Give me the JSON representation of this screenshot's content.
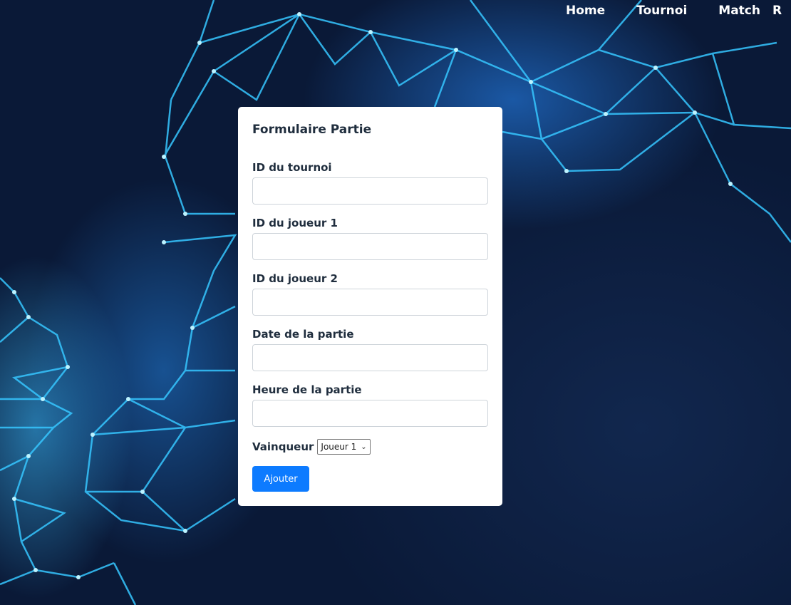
{
  "nav": {
    "items": [
      {
        "label": "Home"
      },
      {
        "label": "Tournoi"
      },
      {
        "label": "Match"
      },
      {
        "label": "R"
      }
    ]
  },
  "form": {
    "title": "Formulaire Partie",
    "fields": [
      {
        "label": "ID du tournoi",
        "value": ""
      },
      {
        "label": "ID du joueur 1",
        "value": ""
      },
      {
        "label": "ID du joueur 2",
        "value": ""
      },
      {
        "label": "Date de la partie",
        "value": ""
      },
      {
        "label": "Heure de la partie",
        "value": ""
      }
    ],
    "winner": {
      "label": "Vainqueur",
      "selected": "Joueur 1",
      "icon": "chevron-down-icon"
    },
    "submit_label": "Ajouter"
  },
  "colors": {
    "accent": "#0d7bff",
    "background": "#0b1d3a",
    "card": "#ffffff",
    "text": "#1f2d3d"
  }
}
